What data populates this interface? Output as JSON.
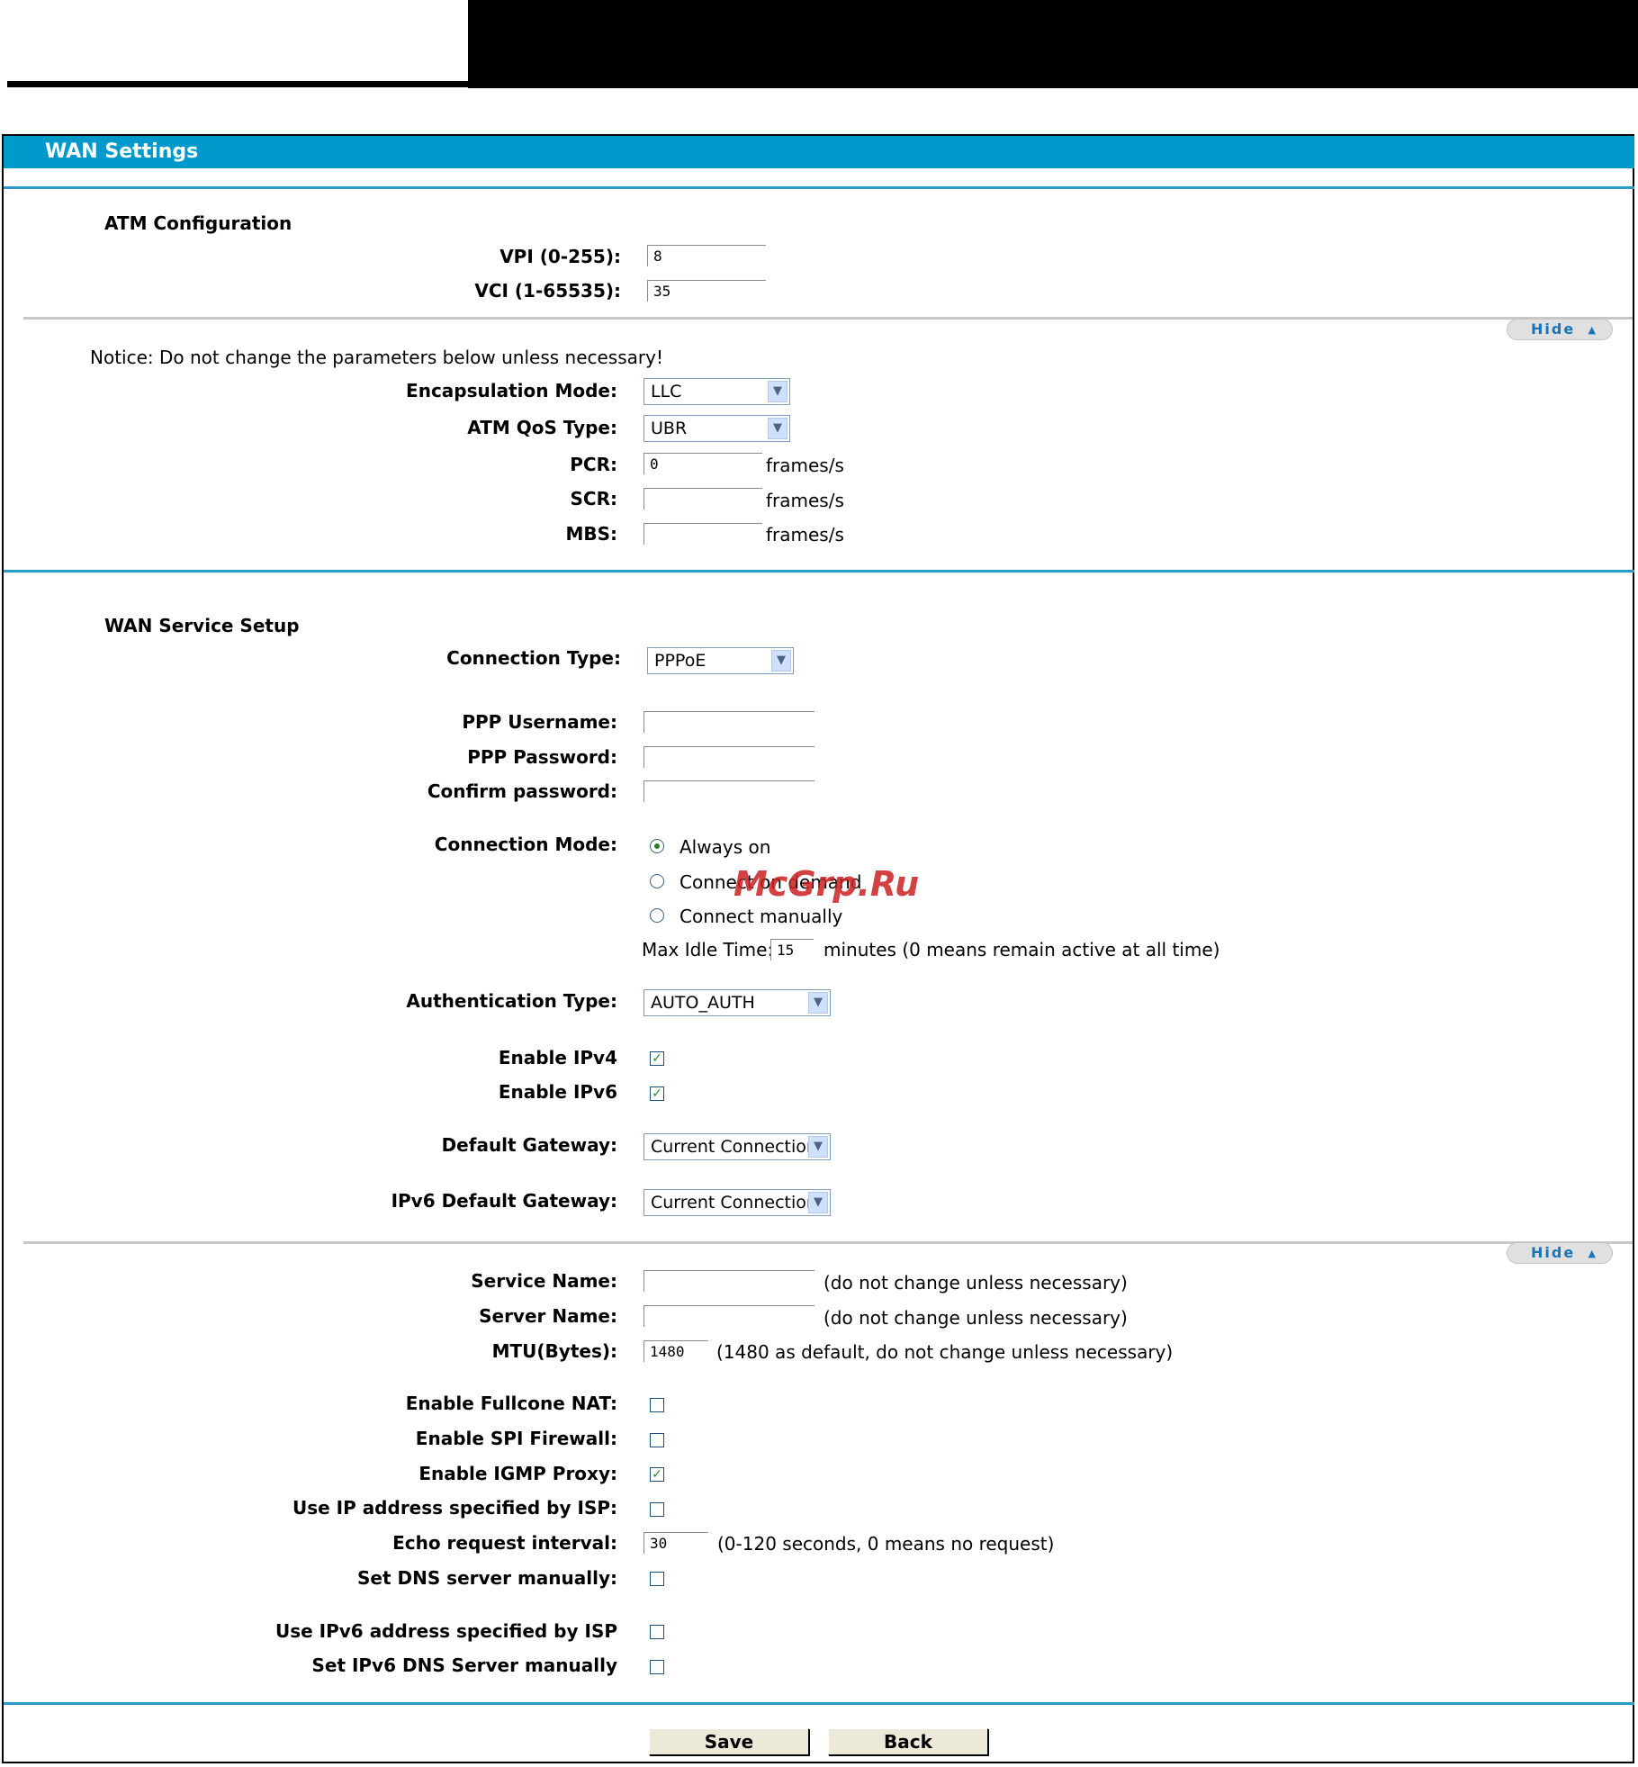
{
  "header": {
    "title": "WAN Settings"
  },
  "atm": {
    "title": "ATM Configuration",
    "vpi_label": "VPI (0-255):",
    "vpi_value": "8",
    "vci_label": "VCI (1-65535):",
    "vci_value": "35"
  },
  "advanced1": {
    "hide_label": "Hide",
    "notice": "Notice: Do not change the parameters below unless necessary!",
    "encap_label": "Encapsulation Mode:",
    "encap_value": "LLC",
    "qos_label": "ATM QoS Type:",
    "qos_value": "UBR",
    "pcr_label": "PCR:",
    "pcr_value": "0",
    "scr_label": "SCR:",
    "scr_value": "",
    "mbs_label": "MBS:",
    "mbs_value": "",
    "unit": "frames/s"
  },
  "wan": {
    "title": "WAN Service Setup",
    "conn_type_label": "Connection Type:",
    "conn_type_value": "PPPoE",
    "user_label": "PPP Username:",
    "user_value": "",
    "pass_label": "PPP Password:",
    "pass_value": "",
    "confirm_label": "Confirm password:",
    "confirm_value": "",
    "mode_label": "Connection Mode:",
    "mode_always": "Always on",
    "mode_demand": "Connect on demand",
    "mode_manual": "Connect manually",
    "mode_selected": "Always on",
    "idle_label": "Max Idle Time:",
    "idle_value": "15",
    "idle_note": "minutes (0 means remain active at all time)",
    "auth_label": "Authentication Type:",
    "auth_value": "AUTO_AUTH",
    "ipv4_label": "Enable IPv4",
    "ipv4_checked": true,
    "ipv6_label": "Enable IPv6",
    "ipv6_checked": true,
    "gw_label": "Default Gateway:",
    "gw_value": "Current Connection",
    "gw6_label": "IPv6 Default Gateway:",
    "gw6_value": "Current Connection"
  },
  "advanced2": {
    "hide_label": "Hide",
    "service_label": "Service Name:",
    "service_value": "",
    "service_note": "(do not change unless necessary)",
    "server_label": "Server Name:",
    "server_value": "",
    "server_note": "(do not change unless necessary)",
    "mtu_label": "MTU(Bytes):",
    "mtu_value": "1480",
    "mtu_note": "(1480 as default, do not change unless necessary)",
    "fullcone_label": "Enable Fullcone NAT:",
    "fullcone_checked": false,
    "spi_label": "Enable SPI Firewall:",
    "spi_checked": false,
    "igmp_label": "Enable IGMP Proxy:",
    "igmp_checked": true,
    "isp_ip_label": "Use IP address specified by ISP:",
    "isp_ip_checked": false,
    "echo_label": "Echo request interval:",
    "echo_value": "30",
    "echo_note": "(0-120 seconds, 0 means no request)",
    "dns_label": "Set DNS server manually:",
    "dns_checked": false,
    "isp_ipv6_label": "Use IPv6 address specified by ISP",
    "isp_ipv6_checked": false,
    "dns6_label": "Set IPv6 DNS Server manually",
    "dns6_checked": false
  },
  "buttons": {
    "save": "Save",
    "back": "Back"
  },
  "watermark": "McGrp.Ru"
}
